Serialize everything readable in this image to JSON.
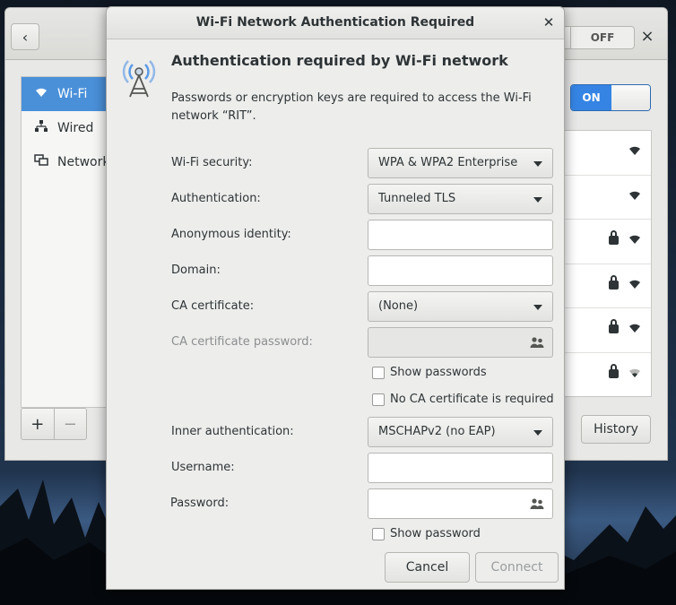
{
  "dialog": {
    "title": "Wi-Fi Network Authentication Required",
    "heading": "Authentication required by Wi-Fi network",
    "description": "Passwords or encryption keys are required to access the Wi-Fi network “RIT”.",
    "icon": "wifi-tower-icon",
    "fields": {
      "wifi_security": {
        "label": "Wi-Fi security:",
        "value": "WPA & WPA2 Enterprise"
      },
      "authentication": {
        "label": "Authentication:",
        "value": "Tunneled TLS"
      },
      "anonymous_identity": {
        "label": "Anonymous identity:",
        "value": ""
      },
      "domain": {
        "label": "Domain:",
        "value": ""
      },
      "ca_certificate": {
        "label": "CA certificate:",
        "value": "(None)"
      },
      "ca_certificate_password": {
        "label": "CA certificate password:",
        "value": ""
      },
      "show_passwords": {
        "label": "Show passwords",
        "checked": false
      },
      "no_ca_required": {
        "label": "No CA certificate is required",
        "checked": false
      },
      "inner_authentication": {
        "label": "Inner authentication:",
        "value": "MSCHAPv2 (no EAP)"
      },
      "username": {
        "label": "Username:",
        "value": ""
      },
      "password": {
        "label": "Password:",
        "value": ""
      },
      "show_password": {
        "label": "Show password",
        "checked": false
      }
    },
    "buttons": {
      "cancel": "Cancel",
      "connect": "Connect"
    }
  },
  "settings": {
    "off_switch": "OFF",
    "on_switch": "ON",
    "sidebar": [
      {
        "label": "Wi-Fi",
        "icon": "wifi-icon",
        "active": true
      },
      {
        "label": "Wired",
        "icon": "wired-network-icon",
        "active": false
      },
      {
        "label": "Network",
        "icon": "network-proxy-icon",
        "active": false
      }
    ],
    "networks": [
      {
        "locked": false,
        "signal": "strong"
      },
      {
        "locked": false,
        "signal": "strong"
      },
      {
        "locked": true,
        "signal": "strong"
      },
      {
        "locked": true,
        "signal": "strong"
      },
      {
        "locked": true,
        "signal": "strong"
      },
      {
        "locked": true,
        "signal": "weak"
      }
    ],
    "history_button": "History",
    "add_button": "+",
    "remove_button": "−"
  },
  "colors": {
    "accent": "#3584e4",
    "selection": "#4a90d9",
    "dialog_bg": "#ededec"
  }
}
